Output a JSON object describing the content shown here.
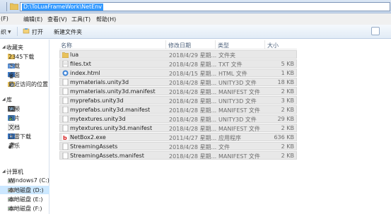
{
  "address": {
    "path": "D:\\ToLuaFrameWork\\NetEnv"
  },
  "menu": [
    "(F)",
    "编辑(E)",
    "查看(V)",
    "工具(T)",
    "帮助(H)"
  ],
  "toolbar": {
    "left_label": "织",
    "open_label": "打开",
    "new_folder_label": "新建文件夹"
  },
  "nav": {
    "favorites": "收藏夹",
    "fav_items": [
      "2345下载",
      "下载",
      "桌面",
      "最近访问的位置"
    ],
    "library": "库",
    "lib_items": [
      "视频",
      "图片",
      "文档",
      "迅雷下载",
      "音乐"
    ],
    "computer": "计算机",
    "drives": [
      "Windows7 (C:)",
      "本地磁盘 (D:)",
      "本地磁盘 (E:)",
      "本地磁盘 (F:)"
    ]
  },
  "columns": {
    "name": "名称",
    "date": "修改日期",
    "type": "类型",
    "size": "大小"
  },
  "files": [
    {
      "name": "lua",
      "date": "2018/4/29 星期...",
      "type": "文件夹",
      "size": "",
      "icon": "folder-icon"
    },
    {
      "name": "files.txt",
      "date": "2018/4/28 星期...",
      "type": "TXT 文件",
      "size": "5 KB",
      "icon": "text-file-icon"
    },
    {
      "name": "index.html",
      "date": "2018/4/15 星期...",
      "type": "HTML 文件",
      "size": "1 KB",
      "icon": "html-file-icon"
    },
    {
      "name": "mymaterials.unity3d",
      "date": "2018/4/28 星期...",
      "type": "UNITY3D 文件",
      "size": "18 KB",
      "icon": "unity-file-icon"
    },
    {
      "name": "mymaterials.unity3d.manifest",
      "date": "2018/4/28 星期...",
      "type": "MANIFEST 文件",
      "size": "2 KB",
      "icon": "manifest-file-icon"
    },
    {
      "name": "myprefabs.unity3d",
      "date": "2018/4/28 星期...",
      "type": "UNITY3D 文件",
      "size": "3 KB",
      "icon": "unity-file-icon"
    },
    {
      "name": "myprefabs.unity3d.manifest",
      "date": "2018/4/28 星期...",
      "type": "MANIFEST 文件",
      "size": "2 KB",
      "icon": "manifest-file-icon"
    },
    {
      "name": "mytextures.unity3d",
      "date": "2018/4/28 星期...",
      "type": "UNITY3D 文件",
      "size": "29 KB",
      "icon": "unity-file-icon"
    },
    {
      "name": "mytextures.unity3d.manifest",
      "date": "2018/4/28 星期...",
      "type": "MANIFEST 文件",
      "size": "2 KB",
      "icon": "manifest-file-icon"
    },
    {
      "name": "NetBox2.exe",
      "date": "2011/4/27 星期...",
      "type": "应用程序",
      "size": "636 KB",
      "icon": "exe-file-icon"
    },
    {
      "name": "StreamingAssets",
      "date": "2018/4/28 星期...",
      "type": "文件",
      "size": "2 KB",
      "icon": "file-icon"
    },
    {
      "name": "StreamingAssets.manifest",
      "date": "2018/4/28 星期...",
      "type": "MANIFEST 文件",
      "size": "2 KB",
      "icon": "manifest-file-icon"
    }
  ]
}
